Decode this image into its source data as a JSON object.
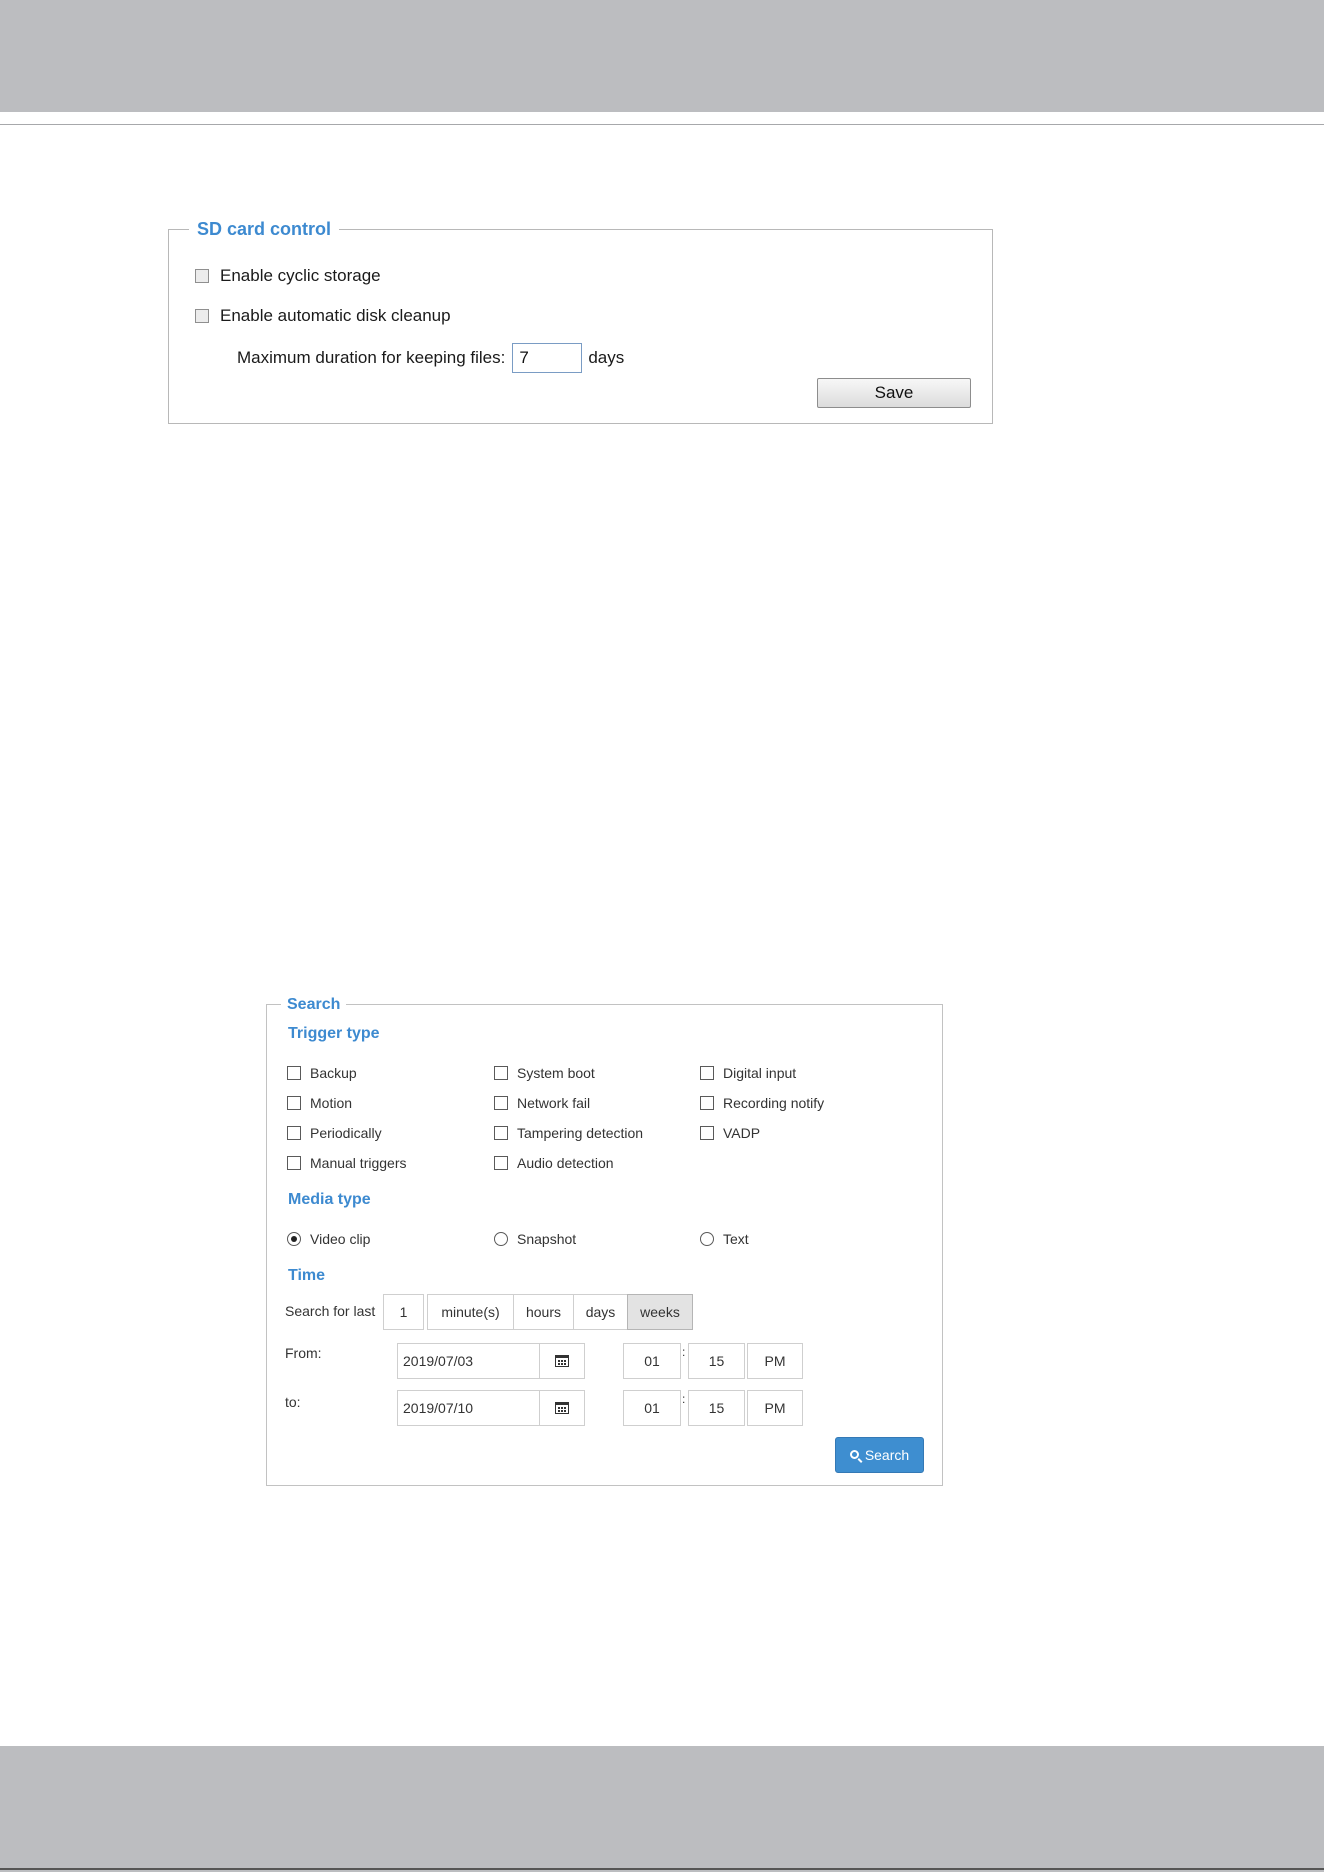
{
  "sd_card_control": {
    "title": "SD card control",
    "cyclic_storage": {
      "label": "Enable cyclic storage",
      "checked": false
    },
    "auto_cleanup": {
      "label": "Enable automatic disk cleanup",
      "checked": false
    },
    "max_duration": {
      "label": "Maximum duration for keeping files:",
      "value": "7",
      "unit": "days"
    },
    "save_label": "Save"
  },
  "search": {
    "title": "Search",
    "trigger_type": {
      "title": "Trigger type",
      "options": {
        "backup": "Backup",
        "system_boot": "System boot",
        "digital_input": "Digital input",
        "motion": "Motion",
        "network_fail": "Network fail",
        "recording_notify": "Recording notify",
        "periodically": "Periodically",
        "tampering_detection": "Tampering detection",
        "vadp": "VADP",
        "manual_triggers": "Manual triggers",
        "audio_detection": "Audio detection"
      }
    },
    "media_type": {
      "title": "Media type",
      "video_clip": "Video clip",
      "snapshot": "Snapshot",
      "text": "Text",
      "selected": "Video clip"
    },
    "time": {
      "title": "Time",
      "search_for_last_label": "Search for last",
      "last_value": "1",
      "units": {
        "minutes": "minute(s)",
        "hours": "hours",
        "days": "days",
        "weeks": "weeks"
      },
      "selected_unit": "weeks",
      "from": {
        "label": "From:",
        "date": "2019/07/03",
        "hour": "01",
        "minute": "15",
        "ampm": "PM"
      },
      "to": {
        "label": "to:",
        "date": "2019/07/10",
        "hour": "01",
        "minute": "15",
        "ampm": "PM"
      },
      "time_separator": ":"
    },
    "search_button_label": "Search"
  },
  "colors": {
    "accent": "#3d8ad0",
    "button_primary": "#3e8ed0",
    "band_gray": "#bcbdc0"
  }
}
